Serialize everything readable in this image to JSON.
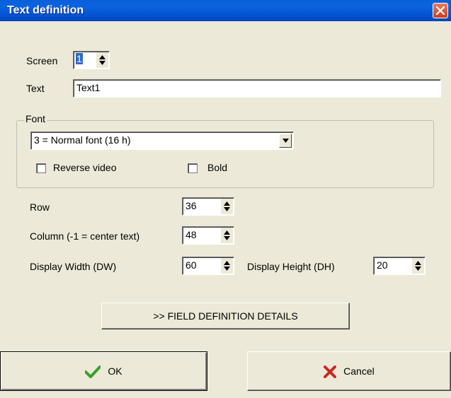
{
  "window": {
    "title": "Text definition"
  },
  "screen": {
    "label": "Screen",
    "value": "1"
  },
  "text": {
    "label": "Text",
    "value": "Text1"
  },
  "font": {
    "group_label": "Font",
    "selected": "3 = Normal font (16 h)",
    "reverse_video_label": "Reverse video",
    "reverse_video_checked": false,
    "bold_label": "Bold",
    "bold_checked": false
  },
  "row": {
    "label": "Row",
    "value": "36"
  },
  "column": {
    "label": "Column (-1 = center text)",
    "value": "48"
  },
  "display_width": {
    "label": "Display Width (DW)",
    "value": "60"
  },
  "display_height": {
    "label": "Display Height (DH)",
    "value": "20"
  },
  "buttons": {
    "field_details": ">> FIELD DEFINITION DETAILS",
    "ok": "OK",
    "cancel": "Cancel"
  },
  "colors": {
    "titlebar": "#0453d2",
    "ok_icon": "#3aa02a",
    "cancel_icon": "#c8281e"
  },
  "icons": [
    "close-icon",
    "checkmark-icon",
    "x-mark-icon",
    "spin-up-icon",
    "spin-down-icon",
    "dropdown-arrow-icon"
  ]
}
